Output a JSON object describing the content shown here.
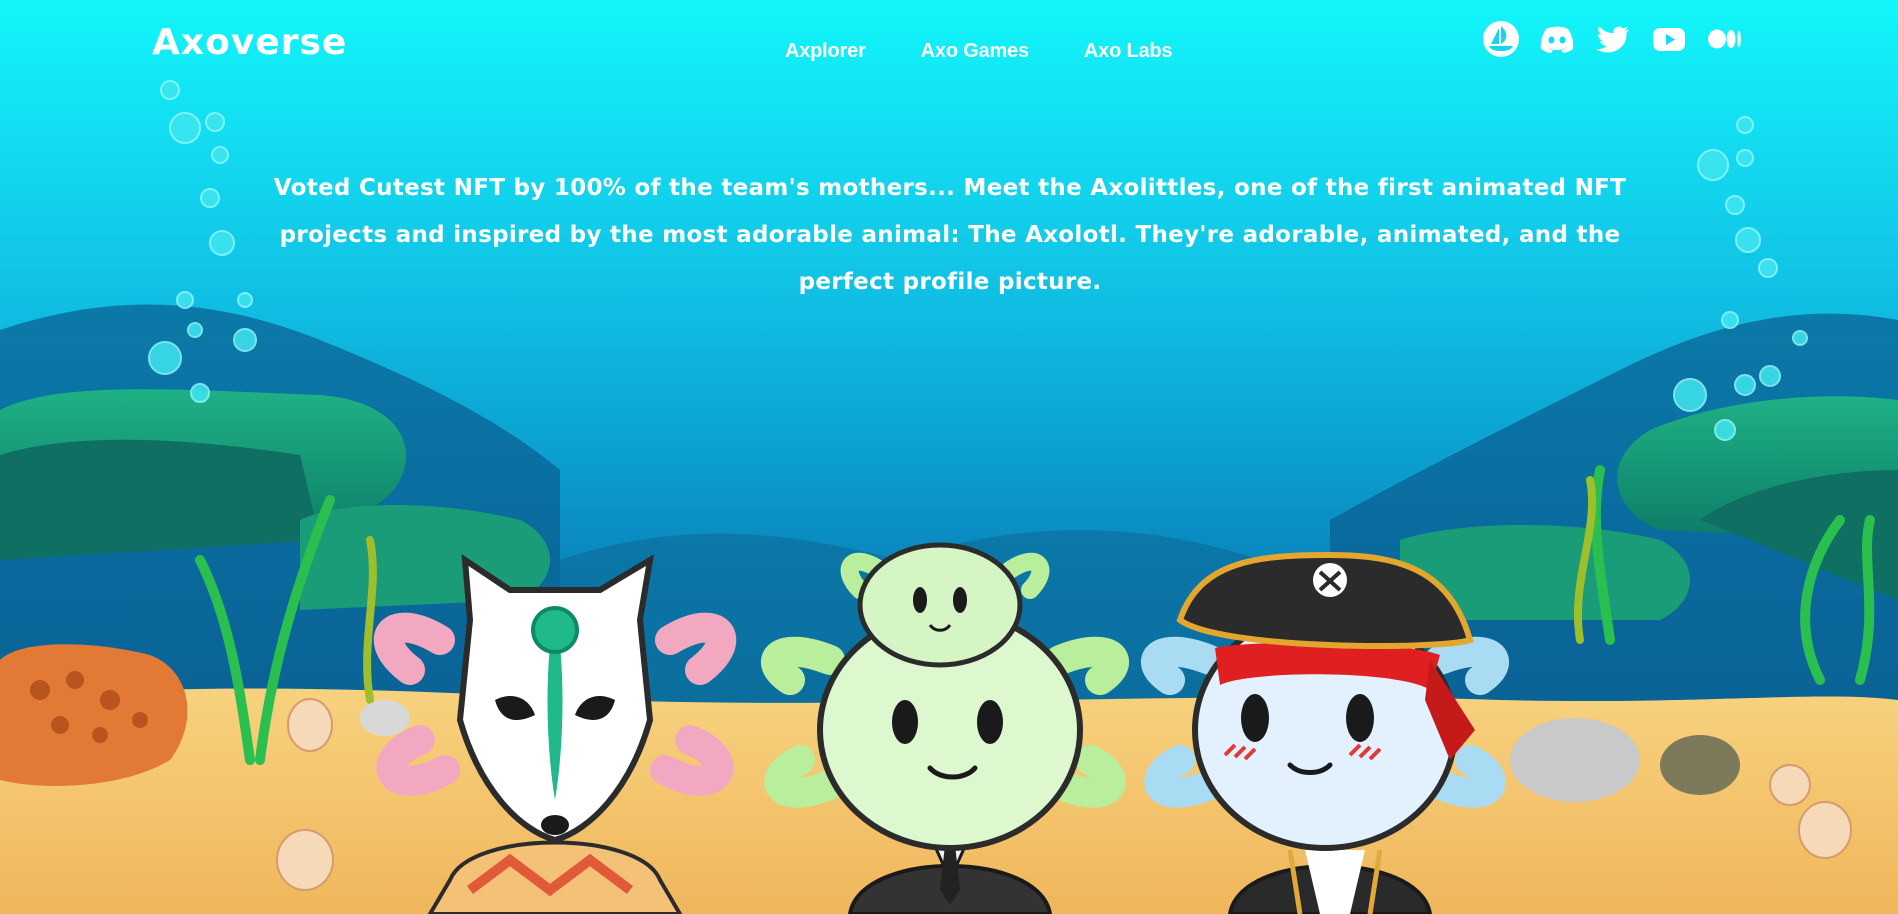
{
  "brand": {
    "logo": "Axoverse"
  },
  "nav": {
    "items": [
      {
        "label": "Axplorer"
      },
      {
        "label": "Axo Games"
      },
      {
        "label": "Axo Labs"
      }
    ]
  },
  "socials": {
    "icons": [
      "opensea-icon",
      "discord-icon",
      "twitter-icon",
      "youtube-icon",
      "medium-icon"
    ]
  },
  "hero": {
    "tagline": "Voted Cutest NFT by 100% of the team's mothers... Meet the Axolittles, one of the first animated NFT projects and inspired by the most adorable animal: The Axolotl. They're adorable, animated, and the perfect profile picture."
  },
  "colors": {
    "sky_top": "#12f6fa",
    "sea_deep": "#0a6a98",
    "sand": "#f6c86f",
    "rock_green": "#1aa67a",
    "text": "#ffffff"
  }
}
